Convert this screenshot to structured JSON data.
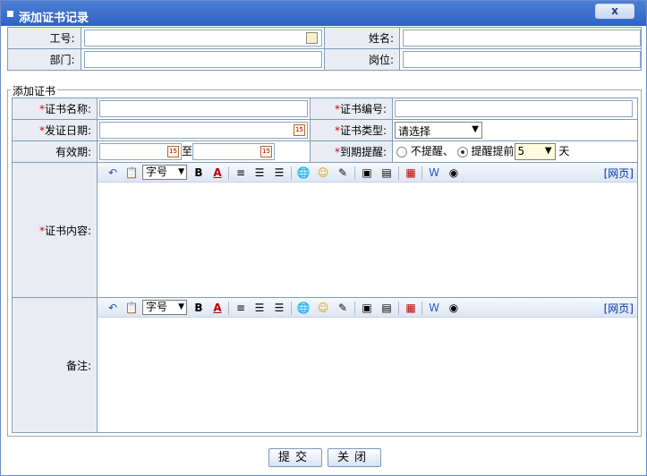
{
  "dialog": {
    "title": "添加证书记录",
    "close_label": "x"
  },
  "top_form": {
    "employee_no_label": "工号:",
    "name_label": "姓名:",
    "dept_label": "部门:",
    "position_label": "岗位:"
  },
  "section": {
    "legend": "添加证书"
  },
  "cert_form": {
    "cert_name_label": "证书名称:",
    "cert_no_label": "证书编号:",
    "issue_date_label": "发证日期:",
    "cert_type_label": "证书类型:",
    "cert_type_value": "请选择",
    "validity_label": "有效期:",
    "validity_to": "至",
    "expiry_remind_label": "到期提醒:",
    "no_remind_label": "不提醒、",
    "remind_ahead_label": "提醒提前",
    "remind_days_value": "5",
    "days_unit": "天",
    "cert_content_label": "证书内容:",
    "remark_label": "备注:",
    "required_mark": "*"
  },
  "editor": {
    "font_size_label": "字号",
    "html_link": "[网页]"
  },
  "buttons": {
    "submit": "提交",
    "close": "关闭"
  },
  "colors": {
    "title_bar": "#2f63c4",
    "label_bg": "#e9edf3",
    "required": "#d40000"
  }
}
